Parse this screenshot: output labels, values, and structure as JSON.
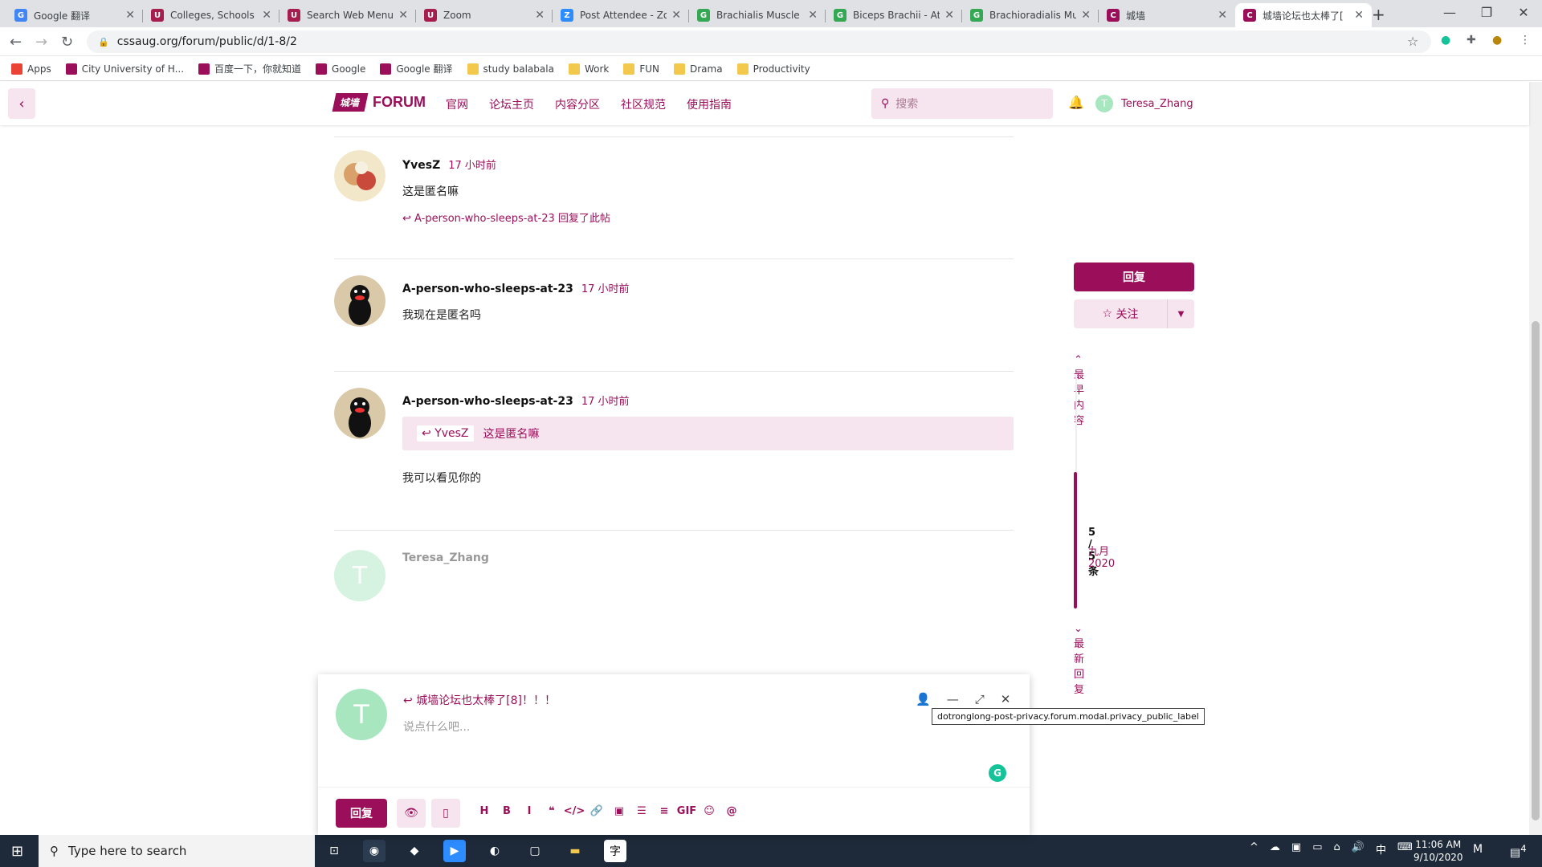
{
  "browser": {
    "tabs": [
      {
        "title": "Google 翻译",
        "color": "#4285f4",
        "glyph": "G"
      },
      {
        "title": "Colleges, Schools and",
        "color": "#a61e4d",
        "glyph": "U"
      },
      {
        "title": "Search Web Menu o",
        "color": "#a61e4d",
        "glyph": "U"
      },
      {
        "title": "Zoom",
        "color": "#a61e4d",
        "glyph": "U"
      },
      {
        "title": "Post Attendee - Zoo",
        "color": "#2d8cff",
        "glyph": "Z"
      },
      {
        "title": "Brachialis Muscle",
        "color": "#34a853",
        "glyph": "G"
      },
      {
        "title": "Biceps Brachii - Atta",
        "color": "#34a853",
        "glyph": "G"
      },
      {
        "title": "Brachioradialis Mus",
        "color": "#34a853",
        "glyph": "G"
      },
      {
        "title": "城墙",
        "color": "#9b0f5a",
        "glyph": "C"
      },
      {
        "title": "城墙论坛也太棒了[",
        "color": "#9b0f5a",
        "glyph": "C"
      }
    ],
    "url": "cssaug.org/forum/public/d/1-8/2",
    "bookmarks": [
      {
        "label": "Apps",
        "type": "apps"
      },
      {
        "label": "City University of H...",
        "type": "site"
      },
      {
        "label": "百度一下，你就知道",
        "type": "site"
      },
      {
        "label": "Google",
        "type": "site"
      },
      {
        "label": "Google 翻译",
        "type": "site"
      },
      {
        "label": "study balabala",
        "type": "folder"
      },
      {
        "label": "Work",
        "type": "folder"
      },
      {
        "label": "FUN",
        "type": "folder"
      },
      {
        "label": "Drama",
        "type": "folder"
      },
      {
        "label": "Productivity",
        "type": "folder"
      }
    ]
  },
  "site": {
    "logo_badge": "城墙",
    "logo_text": "FORUM",
    "nav": [
      "官网",
      "论坛主页",
      "内容分区",
      "社区规范",
      "使用指南"
    ],
    "search_placeholder": "搜索",
    "user": "Teresa_Zhang",
    "user_initial": "T"
  },
  "posts": [
    {
      "user": "YvesZ",
      "time": "17 小时前",
      "body": "这是匿名嘛",
      "replied_by": "A-person-who-sleeps-at-23 回复了此帖"
    },
    {
      "user": "A-person-who-sleeps-at-23",
      "time": "17 小时前",
      "body": "我现在是匿名吗"
    },
    {
      "user": "A-person-who-sleeps-at-23",
      "time": "17 小时前",
      "quote_user": "YvesZ",
      "quote_text": "这是匿名嘛",
      "body": "我可以看见你的"
    },
    {
      "user": "Teresa_Zhang",
      "initial": "T"
    }
  ],
  "sidebar": {
    "reply": "回复",
    "follow": "关注",
    "earliest": "最早内容",
    "count": "5 / 5 条",
    "date": "九月 2020",
    "latest": "最新回复"
  },
  "composer": {
    "initial": "T",
    "title": "城墙论坛也太棒了[8]！！！",
    "placeholder": "说点什么吧...",
    "submit": "回复",
    "tools": [
      "H",
      "B",
      "I",
      "❝",
      "</>",
      "🔗",
      "▣",
      "☰",
      "≡",
      "GIF",
      "☺",
      "@"
    ],
    "tooltip": "dotronglong-post-privacy.forum.modal.privacy_public_label"
  },
  "taskbar": {
    "search_placeholder": "Type here to search",
    "time": "11:06 AM",
    "date": "9/10/2020",
    "ime": "中",
    "notifications": "4"
  }
}
